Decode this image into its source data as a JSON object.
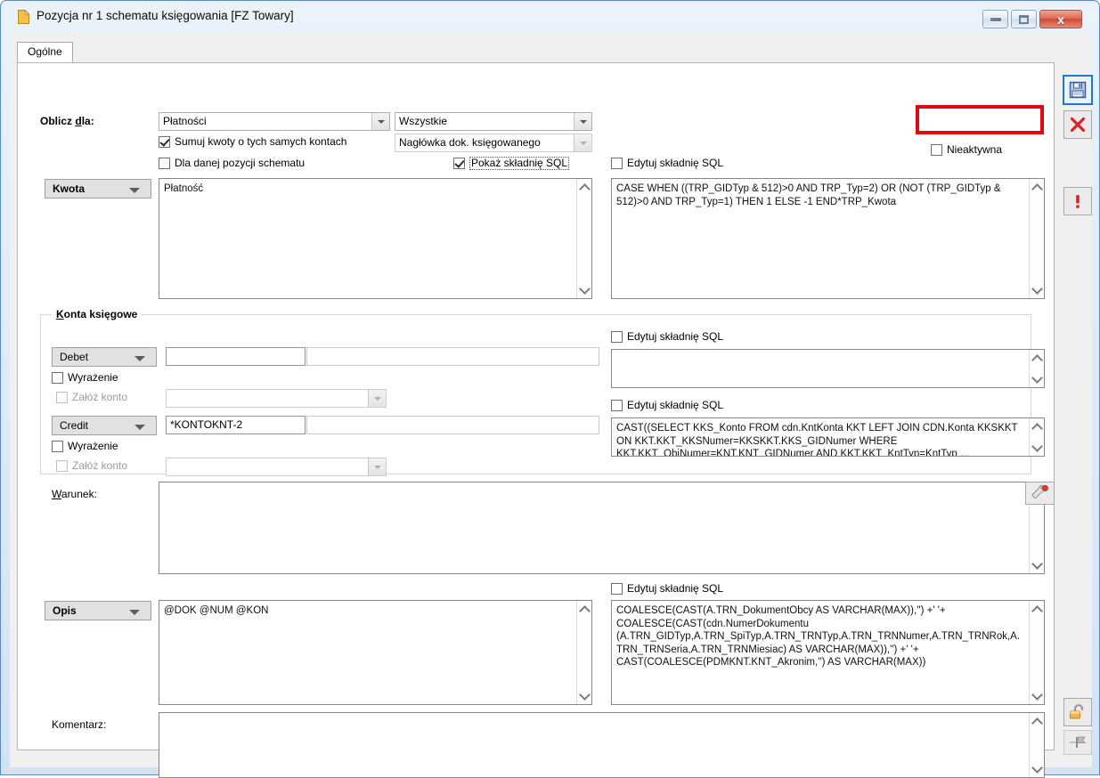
{
  "window": {
    "title": "Pozycja nr 1 schematu księgowania [FZ Towary]",
    "icon": "document-icon",
    "minimize_label": "",
    "maximize_label": "",
    "close_label": "x"
  },
  "tabs": [
    {
      "label": "Ogólne",
      "active": true
    }
  ],
  "oblicz": {
    "label": "Oblicz dla:",
    "label_plain": "Oblicz ",
    "label_underline": "d",
    "label_rest": "la:",
    "combo_source": "Płatności",
    "combo_scope": "Wszystkie",
    "combo_header": "Nagłówka dok. księgowanego",
    "cb_sumuj": "Sumuj kwoty o tych samych kontach",
    "cb_dla_danej": "Dla danej pozycji schematu",
    "cb_pokaz_sql": "Pokaż składnię SQL",
    "cb_nieaktywna": "Nieaktywna"
  },
  "kwota": {
    "dropdown_label": "Kwota",
    "value": "Płatność",
    "sql_checkbox": "Edytuj składnię SQL",
    "sql_value": "CASE WHEN ((TRP_GIDTyp & 512)>0 AND TRP_Typ=2) OR (NOT (TRP_GIDTyp & 512)>0 AND TRP_Typ=1) THEN 1 ELSE -1 END*TRP_Kwota"
  },
  "konta": {
    "caption": "Konta księgowe",
    "caption_underline": "K",
    "caption_rest": "onta księgowe",
    "debet": {
      "dropdown_label": "Debet",
      "account_value": "",
      "account_desc": "",
      "cb_wyrazenie": "Wyrażenie",
      "cb_zaloz_konto": "Załóż konto",
      "zaloz_combo_value": "",
      "sql_checkbox": "Edytuj składnię SQL",
      "sql_value": ""
    },
    "credit": {
      "dropdown_label": "Credit",
      "account_value": "*KONTOKNT-2",
      "account_desc": "",
      "cb_wyrazenie": "Wyrażenie",
      "cb_zaloz_konto": "Załóż konto",
      "zaloz_combo_value": "",
      "sql_checkbox": "Edytuj składnię SQL",
      "sql_value": "CAST((SELECT KKS_Konto FROM cdn.KntKonta KKT LEFT JOIN CDN.Konta KKSKKT ON KKT.KKT_KKSNumer=KKSKKT.KKS_GIDNumer WHERE KKT.KKT_ObiNumer=KNT.KNT_GIDNumer AND KKT.KKT_KntTyp=KntTyp ..."
    }
  },
  "warunek": {
    "label": "Warunek:",
    "label_underline": "W",
    "label_rest": "arunek:",
    "value": "",
    "tool_icon": "wrench-icon"
  },
  "opis": {
    "dropdown_label": "Opis",
    "value": "@DOK @NUM @KON",
    "sql_checkbox": "Edytuj składnię SQL",
    "sql_value": "COALESCE(CAST(A.TRN_DokumentObcy AS VARCHAR(MAX)),'') +' '+ COALESCE(CAST(cdn.NumerDokumentu (A.TRN_GIDTyp,A.TRN_SpiTyp,A.TRN_TRNTyp,A.TRN_TRNNumer,A.TRN_TRNRok,A.TRN_TRNSeria,A.TRN_TRNMiesiac) AS VARCHAR(MAX)),'') +' '+ CAST(COALESCE(PDMKNT.KNT_Akronim,'') AS VARCHAR(MAX))"
  },
  "komentarz": {
    "label": "Komentarz:",
    "value": ""
  },
  "toolbar": {
    "save": {
      "name": "save-icon",
      "tooltip": "Zapisz"
    },
    "cancel": {
      "name": "close-x-icon",
      "tooltip": "Anuluj"
    },
    "warn": {
      "name": "exclamation-icon",
      "tooltip": "!"
    },
    "lock": {
      "name": "unlock-icon",
      "tooltip": "Odblokuj"
    },
    "flag": {
      "name": "flag-icon",
      "tooltip": ""
    }
  },
  "colors": {
    "highlight": "#e30613",
    "accent": "#1c78d4",
    "window_bg": "#f0f0f0",
    "panel_bg": "#ffffff"
  }
}
